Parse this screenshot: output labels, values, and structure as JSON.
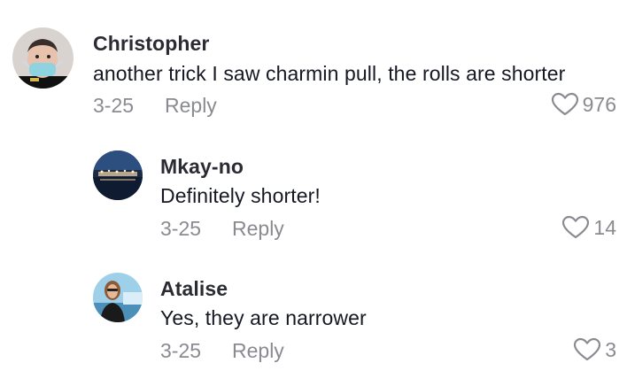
{
  "comments": [
    {
      "username": "Christopher",
      "text": "another trick I saw charmin pull, the rolls are shorter",
      "date": "3-25",
      "reply_label": "Reply",
      "likes": "976",
      "avatar_icon": "avatar-christopher"
    },
    {
      "username": "Mkay-no",
      "text": "Definitely shorter!",
      "date": "3-25",
      "reply_label": "Reply",
      "likes": "14",
      "avatar_icon": "avatar-mkay-no"
    },
    {
      "username": "Atalise",
      "text": "Yes, they are narrower",
      "date": "3-25",
      "reply_label": "Reply",
      "likes": "3",
      "avatar_icon": "avatar-atalise"
    }
  ],
  "colors": {
    "text": "#161823",
    "username": "#2b2b33",
    "muted": "#8a8b91"
  }
}
